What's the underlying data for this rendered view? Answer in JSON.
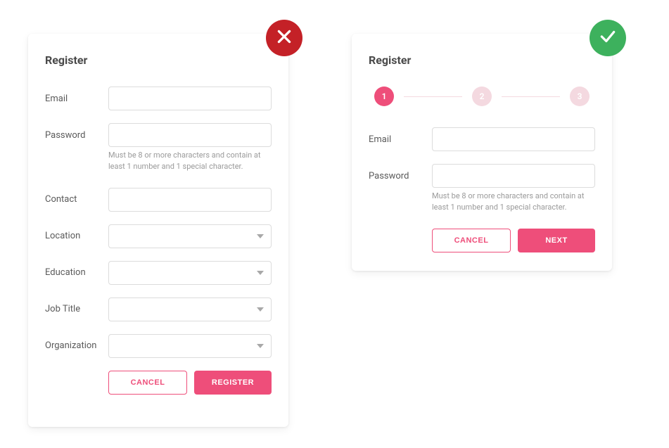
{
  "leftPanel": {
    "title": "Register",
    "fields": {
      "email": "Email",
      "password": "Password",
      "contact": "Contact",
      "location": "Location",
      "education": "Education",
      "jobTitle": "Job Title",
      "organization": "Organization"
    },
    "passwordHint": "Must be 8 or more characters and contain at least 1 number and 1 special character.",
    "buttons": {
      "cancel": "CANCEL",
      "register": "REGISTER"
    }
  },
  "rightPanel": {
    "title": "Register",
    "steps": {
      "step1": "1",
      "step2": "2",
      "step3": "3"
    },
    "fields": {
      "email": "Email",
      "password": "Password"
    },
    "passwordHint": "Must be 8 or more characters and contain at least 1 number and 1 special character.",
    "buttons": {
      "cancel": "CANCEL",
      "next": "NEXT"
    }
  },
  "colors": {
    "accent": "#ee4e7a",
    "wrongBadge": "#c42127",
    "rightBadge": "#3db15d"
  }
}
